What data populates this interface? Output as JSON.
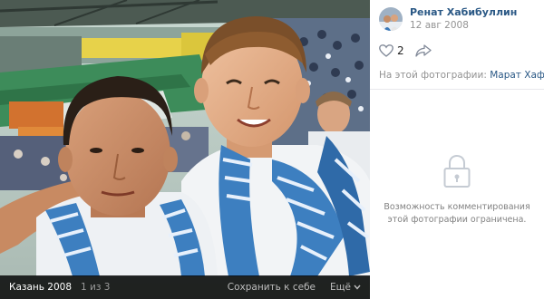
{
  "photo": {
    "place": "Казань 2008",
    "counter": "1 из 3",
    "save_label": "Сохранить к себе",
    "more_label": "Ещё"
  },
  "author": {
    "name": "Ренат Хабибуллин",
    "date": "12 авг 2008"
  },
  "likes": {
    "count": "2"
  },
  "tagged": {
    "prefix": "На этой фотографии:",
    "person": "Марат Хафизов"
  },
  "comments": {
    "closed_text": "Возможность комментирования этой фотографии ограничена."
  },
  "colors": {
    "link": "#2a5885",
    "muted": "#939393",
    "scarf_blue": "#3d7fc0",
    "bar_bg": "#000000"
  },
  "icons": [
    "heart-icon",
    "share-icon",
    "lock-icon",
    "chevron-down-icon"
  ]
}
